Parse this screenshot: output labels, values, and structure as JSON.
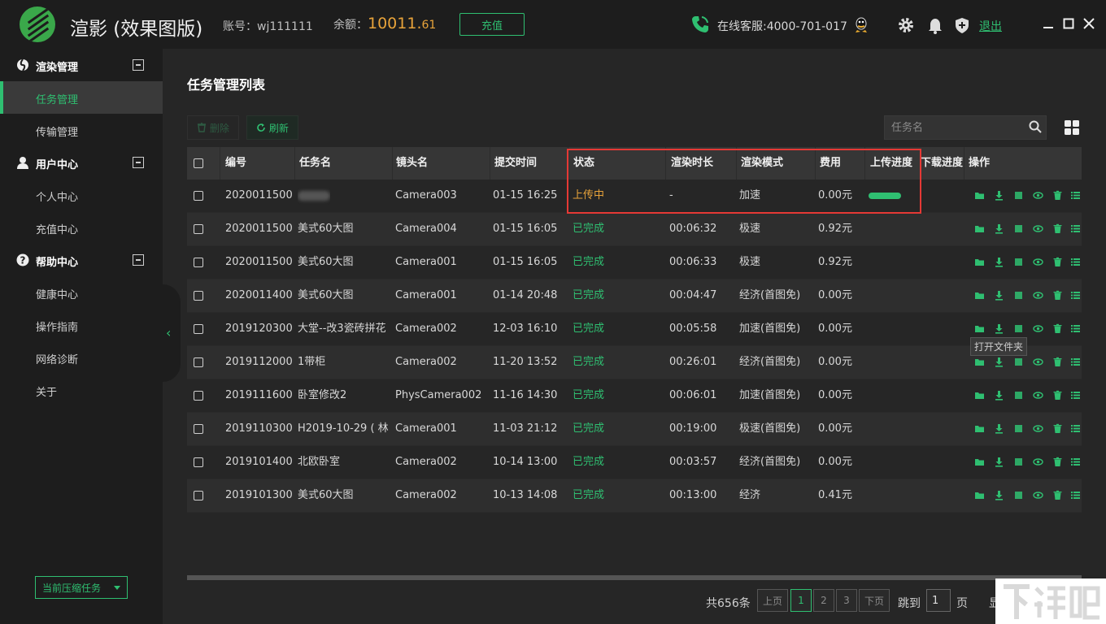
{
  "header": {
    "title": "渲影 (效果图版)",
    "account": "账号：wj111111",
    "balance_label": "余额：",
    "balance_int": "10011.",
    "balance_dec": "61",
    "recharge": "充值",
    "hotline": "在线客服:4000-701-017",
    "logout": "退出"
  },
  "sidebar": {
    "sections": [
      {
        "label": "渲染管理",
        "icon": "render-icon",
        "items": [
          "任务管理",
          "传输管理"
        ]
      },
      {
        "label": "用户中心",
        "icon": "user-icon",
        "items": [
          "个人中心",
          "充值中心"
        ]
      },
      {
        "label": "帮助中心",
        "icon": "help-icon",
        "items": [
          "健康中心",
          "操作指南",
          "网络诊断",
          "关于"
        ]
      }
    ],
    "active_item": "任务管理",
    "compress_button": "当前压缩任务"
  },
  "main": {
    "title": "任务管理列表",
    "delete_label": "删除",
    "refresh_label": "刷新",
    "search_placeholder": "任务名"
  },
  "table": {
    "columns": [
      "编号",
      "任务名",
      "镜头名",
      "提交时间",
      "状态",
      "渲染时长",
      "渲染模式",
      "费用",
      "上传进度",
      "下载进度",
      "操作"
    ],
    "rows": [
      {
        "id": "2020011500",
        "name": "",
        "camera": "Camera003",
        "time": "01-15 16:25",
        "status": "上传中",
        "duration": "-",
        "mode": "加速",
        "cost": "0.00元",
        "uploading": true
      },
      {
        "id": "2020011500",
        "name": "美式60大图",
        "camera": "Camera004",
        "time": "01-15 16:05",
        "status": "已完成",
        "duration": "00:06:32",
        "mode": "极速",
        "cost": "0.92元"
      },
      {
        "id": "2020011500",
        "name": "美式60大图",
        "camera": "Camera001",
        "time": "01-15 16:05",
        "status": "已完成",
        "duration": "00:06:33",
        "mode": "极速",
        "cost": "0.92元"
      },
      {
        "id": "2020011400",
        "name": "美式60大图",
        "camera": "Camera001",
        "time": "01-14 20:48",
        "status": "已完成",
        "duration": "00:04:47",
        "mode": "经济(首图免)",
        "cost": "0.00元"
      },
      {
        "id": "2019120300",
        "name": "大堂--改3瓷砖拼花",
        "camera": "Camera002",
        "time": "12-03 16:10",
        "status": "已完成",
        "duration": "00:05:58",
        "mode": "加速(首图免)",
        "cost": "0.00元"
      },
      {
        "id": "2019112000",
        "name": "1带柜",
        "camera": "Camera002",
        "time": "11-20 13:52",
        "status": "已完成",
        "duration": "00:26:01",
        "mode": "经济(首图免)",
        "cost": "0.00元"
      },
      {
        "id": "2019111600",
        "name": "卧室修改2",
        "camera": "PhysCamera002",
        "time": "11-16 14:30",
        "status": "已完成",
        "duration": "00:06:01",
        "mode": "加速(首图免)",
        "cost": "0.00元"
      },
      {
        "id": "2019110300",
        "name": "H2019-10-29 ( 林",
        "camera": "Camera001",
        "time": "11-03 21:12",
        "status": "已完成",
        "duration": "00:19:00",
        "mode": "极速(首图免)",
        "cost": "0.00元"
      },
      {
        "id": "2019101400",
        "name": "北欧卧室",
        "camera": "Camera002",
        "time": "10-14 13:00",
        "status": "已完成",
        "duration": "00:03:57",
        "mode": "经济(首图免)",
        "cost": "0.00元"
      },
      {
        "id": "2019101300",
        "name": "美式60大图",
        "camera": "Camera002",
        "time": "10-13 14:08",
        "status": "已完成",
        "duration": "00:13:00",
        "mode": "经济",
        "cost": "0.41元"
      }
    ]
  },
  "upload_progress": 1.0,
  "tooltip": "打开文件夹",
  "pagination": {
    "total": "共656条",
    "prev": "上页",
    "pages": [
      "1",
      "2",
      "3"
    ],
    "current": "1",
    "next": "下页",
    "jump_label": "跳到",
    "jump_value": "1",
    "page_suffix": "页",
    "cut_text": "显"
  },
  "watermark": "下载吧",
  "colors": {
    "accent": "#2fbf71",
    "warning": "#e8a33a",
    "highlight": "#e53935"
  }
}
